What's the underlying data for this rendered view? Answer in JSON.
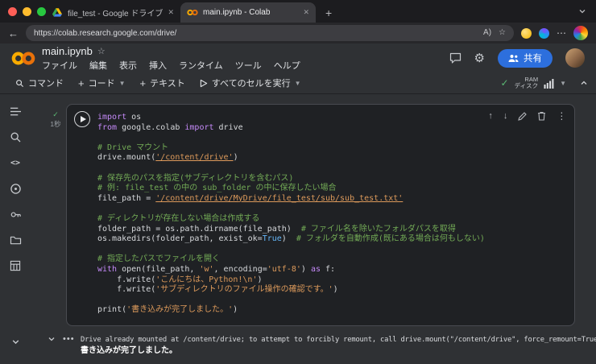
{
  "browser": {
    "tabs": [
      {
        "title": "file_test - Google ドライブ"
      },
      {
        "title": "main.ipynb - Colab"
      }
    ],
    "url": "https://colab.research.google.com/drive/",
    "read_aloud_label": "A)",
    "favorite_star": "☆"
  },
  "colab": {
    "title": "main.ipynb",
    "star": "☆",
    "menus": [
      "ファイル",
      "編集",
      "表示",
      "挿入",
      "ランタイム",
      "ツール",
      "ヘルプ"
    ],
    "share_label": "共有",
    "toolbar": {
      "command_label": "コマンド",
      "add_code_label": "コード",
      "add_text_label": "テキスト",
      "run_all_label": "すべてのセルを実行",
      "ram_label": "RAM",
      "disk_label": "ディスク"
    }
  },
  "cell": {
    "exec_time": "1秒",
    "code_lines": [
      [
        [
          "kw",
          "import"
        ],
        [
          "pl",
          " os"
        ]
      ],
      [
        [
          "kw",
          "from"
        ],
        [
          "pl",
          " google.colab "
        ],
        [
          "kw",
          "import"
        ],
        [
          "pl",
          " drive"
        ]
      ],
      [],
      [
        [
          "cm",
          "# Drive マウント"
        ]
      ],
      [
        [
          "pl",
          "drive.mount("
        ],
        [
          "strU",
          "'/content/drive'"
        ],
        [
          "pl",
          ")"
        ]
      ],
      [],
      [
        [
          "cm",
          "# 保存先のパスを指定(サブディレクトリを含むパス)"
        ]
      ],
      [
        [
          "cm",
          "# 例: file_test の中の sub_folder の中に保存したい場合"
        ]
      ],
      [
        [
          "pl",
          "file_path = "
        ],
        [
          "strU",
          "'/content/drive/MyDrive/file_test/sub/sub_test.txt'"
        ]
      ],
      [],
      [
        [
          "cm",
          "# ディレクトリが存在しない場合は作成する"
        ]
      ],
      [
        [
          "pl",
          "folder_path = os.path.dirname(file_path)  "
        ],
        [
          "cm",
          "# ファイル名を除いたフォルダパスを取得"
        ]
      ],
      [
        [
          "pl",
          "os.makedirs(folder_path, exist_ok="
        ],
        [
          "const",
          "True"
        ],
        [
          "pl",
          ")  "
        ],
        [
          "cm",
          "# フォルダを自動作成(既にある場合は何もしない)"
        ]
      ],
      [],
      [
        [
          "cm",
          "# 指定したパスでファイルを開く"
        ]
      ],
      [
        [
          "kw",
          "with"
        ],
        [
          "pl",
          " open(file_path, "
        ],
        [
          "str",
          "'w'"
        ],
        [
          "pl",
          ", encoding="
        ],
        [
          "str",
          "'utf-8'"
        ],
        [
          "pl",
          ") "
        ],
        [
          "kw",
          "as"
        ],
        [
          "pl",
          " f:"
        ]
      ],
      [
        [
          "pl",
          "    f.write("
        ],
        [
          "str",
          "'こんにちは、Python!\\n'"
        ],
        [
          "pl",
          ")"
        ]
      ],
      [
        [
          "pl",
          "    f.write("
        ],
        [
          "str",
          "'サブディレクトリのファイル操作の確認です。'"
        ],
        [
          "pl",
          ")"
        ]
      ],
      [],
      [
        [
          "pl",
          "print("
        ],
        [
          "str",
          "'書き込みが完了しました。'"
        ],
        [
          "pl",
          ")"
        ]
      ]
    ],
    "output_lines": [
      {
        "text": "Drive already mounted at /content/drive; to attempt to forcibly remount, call drive.mount(\"/content/drive\", force_remount=True).",
        "bold": false
      },
      {
        "text": "書き込みが完了しました。",
        "bold": true
      }
    ]
  },
  "colors": {
    "accent_blue": "#2d6fdd",
    "success_green": "#5bb974",
    "keyword": "#c58af9",
    "string": "#dd9a5b",
    "comment": "#73ab56",
    "constant": "#64b5f6",
    "colab_orange": "#f9ab00"
  }
}
